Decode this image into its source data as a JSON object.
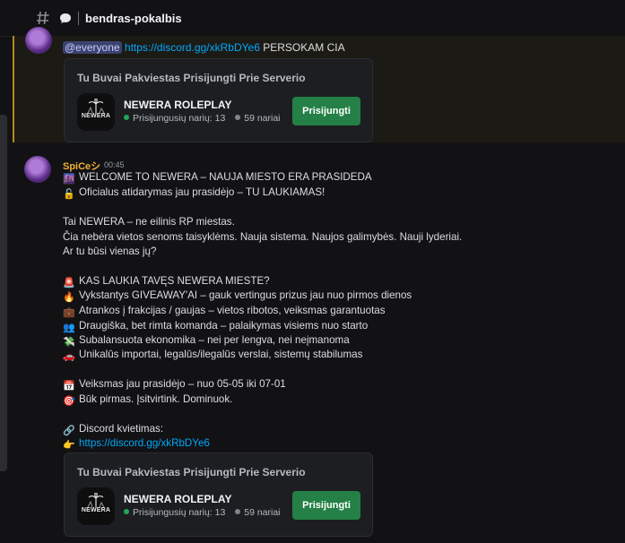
{
  "header": {
    "channel_name": "bendras-pokalbis"
  },
  "message1": {
    "mention": "@everyone",
    "link": "https://discord.gg/xkRbDYe6",
    "text_after": "PERSOKAM CIA",
    "invite": {
      "title": "Tu Buvai Pakviestas Prisijungti Prie Serverio",
      "server_name": "NEWERA ROLEPLAY",
      "logo_text": "NEWERA",
      "online": "Prisijungusių narių: 13",
      "members": "59 nariai",
      "join_label": "Prisijungti"
    }
  },
  "message2": {
    "author": "SpiCeシ",
    "time": "00:45",
    "lines": [
      {
        "emoji": "🌆",
        "text": "WELCOME TO NEWERA – NAUJA MIESTO ERA PRASIDEDA"
      },
      {
        "emoji": "🔓",
        "text": "Oficialus atidarymas jau prasidėjo – TU LAUKIAMAS!"
      },
      {
        "emoji": "",
        "text": "Tai NEWERA – ne eilinis RP miestas."
      },
      {
        "emoji": "",
        "text": "Čia nebėra vietos senoms taisyklėms. Nauja sistema. Naujos galimybės. Nauji lyderiai."
      },
      {
        "emoji": "",
        "text": "Ar tu būsi vienas jų?"
      },
      {
        "emoji": "🚨",
        "text": "KAS LAUKIA TAVĘS NEWERA MIESTE?"
      },
      {
        "emoji": "🔥",
        "text": "Vykstantys GIVEAWAY'AI – gauk vertingus prizus jau nuo pirmos dienos"
      },
      {
        "emoji": "💼",
        "text": "Atrankos į frakcijas / gaujas – vietos ribotos, veiksmas garantuotas"
      },
      {
        "emoji": "👥",
        "text": "Draugiška, bet rimta komanda – palaikymas visiems nuo starto"
      },
      {
        "emoji": "💸",
        "text": "Subalansuota ekonomika – nei per lengva, nei neįmanoma"
      },
      {
        "emoji": "🚗",
        "text": "Unikalūs importai, legalūs/ilegalūs verslai, sistemų stabilumas"
      },
      {
        "emoji": "📅",
        "text": "Veiksmas jau prasidėjo – nuo 05-05 iki 07-01"
      },
      {
        "emoji": "🎯",
        "text": "Būk pirmas. Įsitvirtink. Dominuok."
      },
      {
        "emoji": "🔗",
        "text": "Discord kvietimas:"
      },
      {
        "emoji": "👉",
        "text": "https://discord.gg/xkRbDYe6"
      }
    ],
    "invite": {
      "title": "Tu Buvai Pakviestas Prisijungti Prie Serverio",
      "server_name": "NEWERA ROLEPLAY",
      "logo_text": "NEWERA",
      "online": "Prisijungusių narių: 13",
      "members": "59 nariai",
      "join_label": "Prisijungti"
    }
  }
}
